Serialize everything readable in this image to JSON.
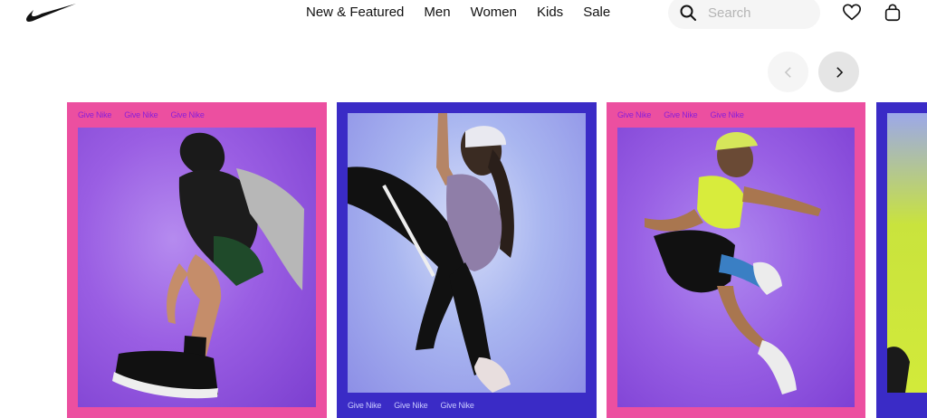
{
  "header": {
    "logo": "nike-swoosh",
    "nav": [
      "New & Featured",
      "Men",
      "Women",
      "Kids",
      "Sale"
    ],
    "search_placeholder": "Search",
    "icons": {
      "search": "search-icon",
      "favorites": "heart-icon",
      "bag": "bag-icon"
    }
  },
  "carousel": {
    "prev_icon": "chevron-left-icon",
    "next_icon": "chevron-right-icon",
    "cards": [
      {
        "band": "Give Nike",
        "band_position": "top",
        "frame_color": "#ec4fa0"
      },
      {
        "band": "Give Nike",
        "band_position": "bottom",
        "frame_color": "#3a2bc6"
      },
      {
        "band": "Give Nike",
        "band_position": "top",
        "frame_color": "#ec4fa0"
      },
      {
        "band": "",
        "band_position": "bottom",
        "frame_color": "#3a2bc6"
      }
    ]
  }
}
